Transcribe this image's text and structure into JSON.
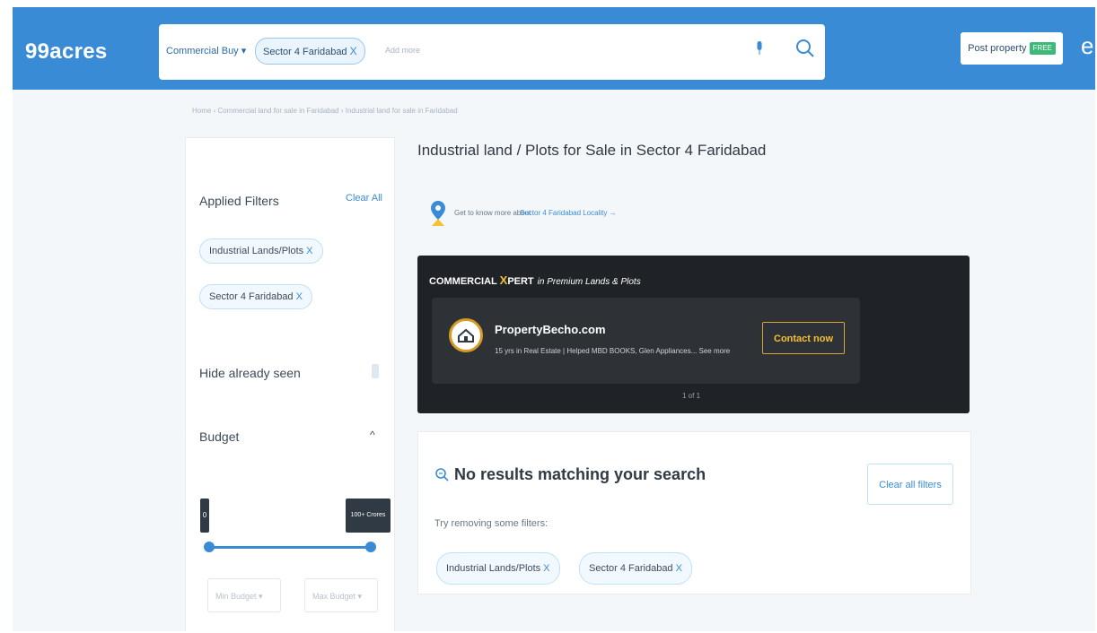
{
  "header": {
    "logo": "99acres",
    "category": "Commercial Buy ▾",
    "search_chip": "Sector 4 Faridabad",
    "chip_close": "X",
    "add_more_placeholder": "Add more",
    "post_property_label": "Post property",
    "free_badge": "FREE",
    "trailing_initial": "e"
  },
  "breadcrumb": "Home › Commercial land for sale in Faridabad › Industrial land for sale in Faridabad",
  "filters": {
    "applied_title": "Applied Filters",
    "clear_all": "Clear All",
    "chips": [
      "Industrial Lands/Plots",
      "Sector 4 Faridabad"
    ],
    "close": "X",
    "hide_seen": "Hide already seen",
    "budget_title": "Budget",
    "budget_caret": "^",
    "budget_min_label": "0",
    "budget_max_label": "100+ Crores",
    "min_budget_placeholder": "Min Budget ▾",
    "max_budget_placeholder": "Max Budget ▾"
  },
  "main": {
    "title": "Industrial land / Plots for Sale in Sector 4 Faridabad",
    "locality_prefix": "Get to know more about",
    "locality_link": "Sector 4 Faridabad Locality →"
  },
  "banner": {
    "brand_prefix": "COMMERCIAL ",
    "brand_x": "X",
    "brand_suffix": "PERT",
    "subtitle": "in Premium Lands & Plots",
    "company": "PropertyBecho.com",
    "description": "15 yrs in Real Estate | Helped MBD BOOKS, Glen Appliances... See more",
    "cta": "Contact now",
    "pager": "1 of 1"
  },
  "no_results": {
    "title": "No results matching your search",
    "clear_filters": "Clear all filters",
    "try_text": "Try removing some filters:",
    "chips": [
      "Industrial Lands/Plots",
      "Sector 4 Faridabad"
    ],
    "close": "X"
  },
  "colors": {
    "header_blue": "#3a8bd6",
    "banner_dark": "#1f2226",
    "gold": "#f5c131"
  },
  "icons": [
    "microphone-icon",
    "search-icon",
    "location-pin-icon",
    "search-zoom-icon",
    "company-logo-icon"
  ]
}
